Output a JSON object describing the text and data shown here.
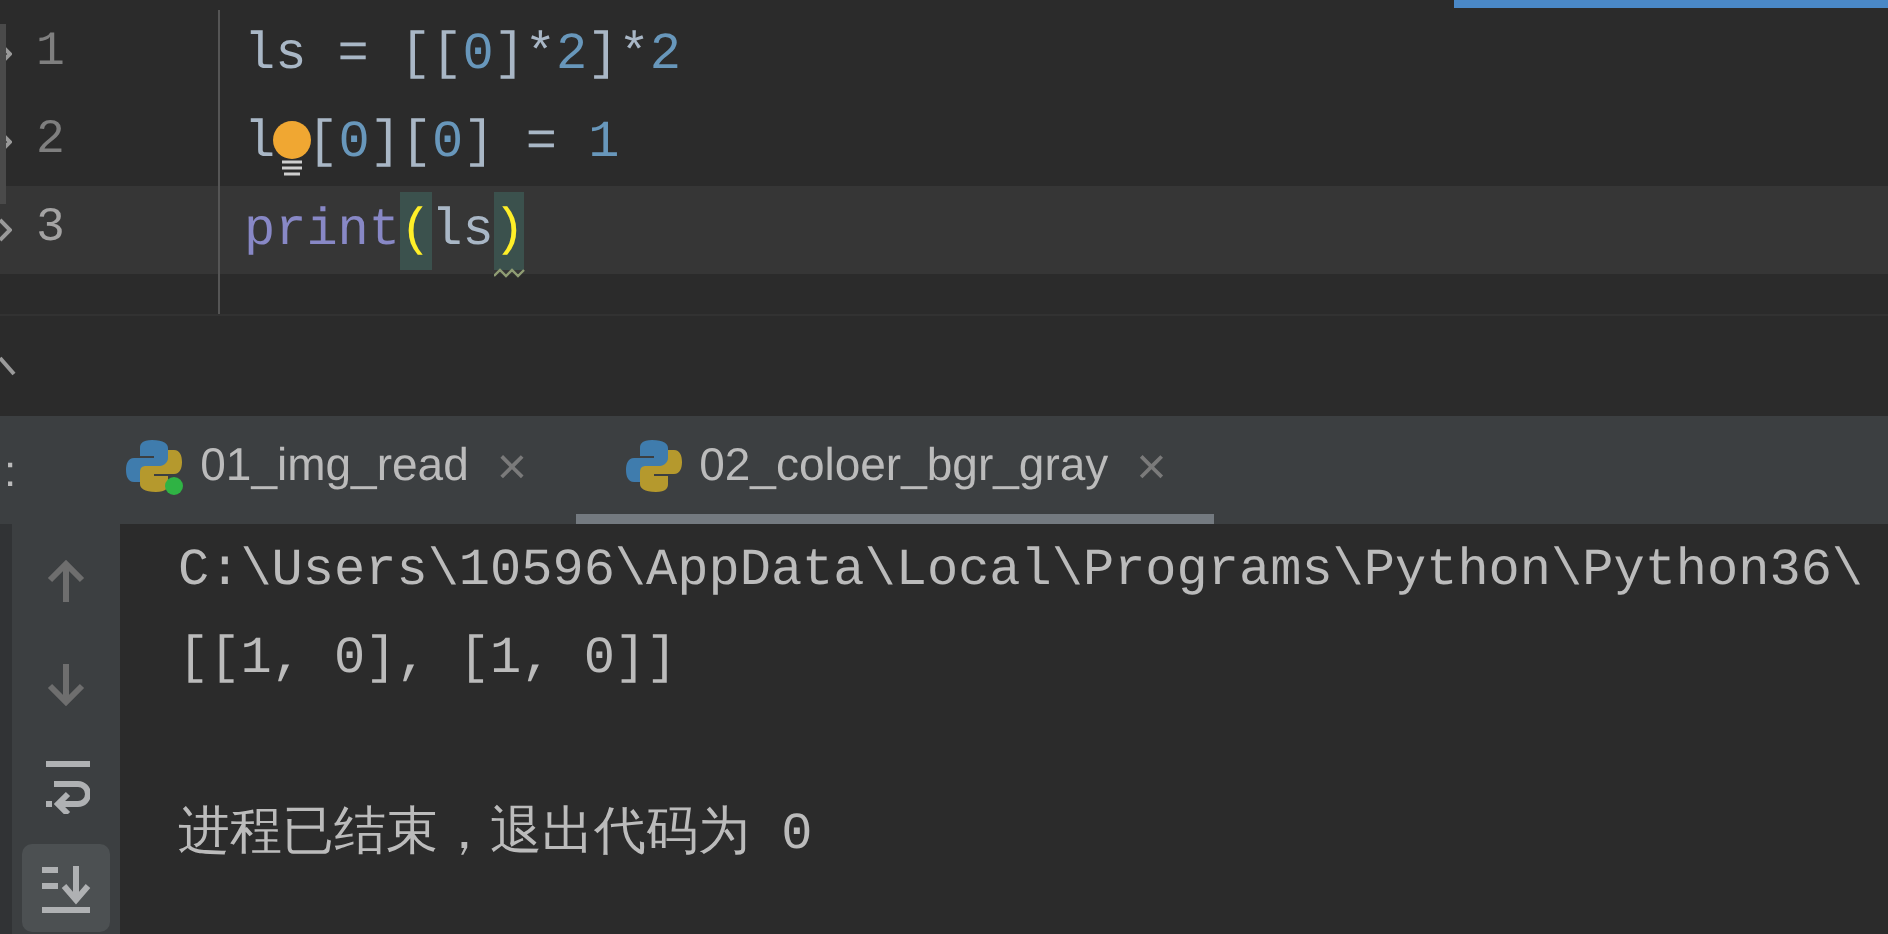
{
  "editor": {
    "lines": [
      {
        "number": "1",
        "current": false,
        "tokens": [
          {
            "kind": "plain",
            "text": "ls = [["
          },
          {
            "kind": "number",
            "text": "0"
          },
          {
            "kind": "plain",
            "text": "]*"
          },
          {
            "kind": "number",
            "text": "2"
          },
          {
            "kind": "plain",
            "text": "]*"
          },
          {
            "kind": "number",
            "text": "2"
          }
        ]
      },
      {
        "number": "2",
        "current": false,
        "tokens": [
          {
            "kind": "plain",
            "text": "l"
          },
          {
            "kind": "bulb"
          },
          {
            "kind": "plain",
            "text": "["
          },
          {
            "kind": "number",
            "text": "0"
          },
          {
            "kind": "plain",
            "text": "]["
          },
          {
            "kind": "number",
            "text": "0"
          },
          {
            "kind": "plain",
            "text": "] = "
          },
          {
            "kind": "number",
            "text": "1"
          }
        ]
      },
      {
        "number": "3",
        "current": true,
        "tokens": [
          {
            "kind": "builtin",
            "text": "print"
          },
          {
            "kind": "paren",
            "text": "("
          },
          {
            "kind": "plain",
            "text": "ls"
          },
          {
            "kind": "paren",
            "text": ")",
            "squiggle": true
          }
        ]
      }
    ]
  },
  "run_panel": {
    "label": ":",
    "tabs": [
      {
        "title": "01_img_read",
        "running": true,
        "selected": false,
        "close": "×"
      },
      {
        "title": "02_coloer_bgr_gray",
        "running": false,
        "selected": true,
        "close": "×"
      }
    ]
  },
  "console": {
    "toolbar": [
      {
        "kind": "up",
        "disabled": true,
        "selected": false
      },
      {
        "kind": "down",
        "disabled": true,
        "selected": false
      },
      {
        "kind": "wrap",
        "disabled": false,
        "selected": false
      },
      {
        "kind": "scroll_end",
        "disabled": false,
        "selected": true
      }
    ],
    "output_blocks": [
      {
        "lines": [
          "C:\\Users\\10596\\AppData\\Local\\Programs\\Python\\Python36\\",
          "[[1, 0], [1, 0]]"
        ]
      },
      {
        "lines": [
          "进程已结束，退出代码为 0"
        ]
      }
    ]
  }
}
